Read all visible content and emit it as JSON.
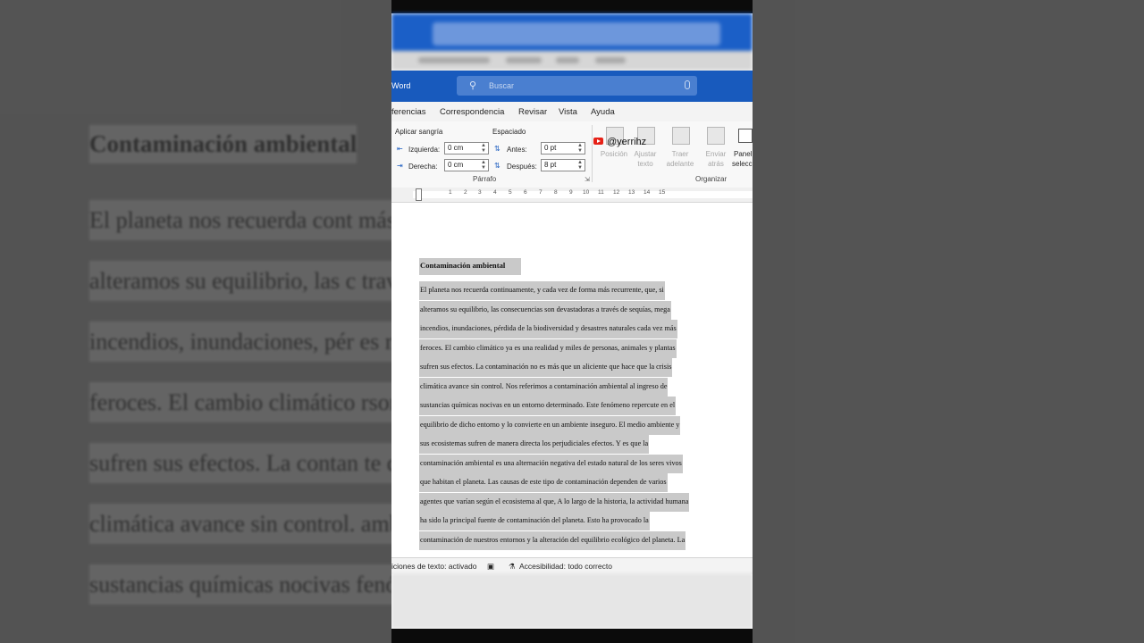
{
  "app": {
    "name": "Word"
  },
  "search": {
    "placeholder": "Buscar"
  },
  "tabs": [
    "ferencias",
    "Correspondencia",
    "Revisar",
    "Vista",
    "Ayuda"
  ],
  "ribbon": {
    "indent_label": "Aplicar sangría",
    "left_label": "Izquierda:",
    "left_value": "0 cm",
    "right_label": "Derecha:",
    "right_value": "0 cm",
    "spacing_label": "Espaciado",
    "before_label": "Antes:",
    "before_value": "0 pt",
    "after_label": "Después:",
    "after_value": "8 pt",
    "paragraph_group": "Párrafo",
    "organize_group": "Organizar",
    "position_label": "Posición",
    "wrap_label_1": "Ajustar",
    "wrap_label_2": "texto",
    "forward_label_1": "Traer",
    "forward_label_2": "adelante",
    "backward_label_1": "Enviar",
    "backward_label_2": "atrás",
    "pane_label_1": "Panel",
    "pane_label_2": "selecc"
  },
  "watermark": "@yerrihz",
  "ruler": {
    "ticks": [
      "1",
      "2",
      "3",
      "4",
      "5",
      "6",
      "7",
      "8",
      "9",
      "10",
      "11",
      "12",
      "13",
      "14",
      "15"
    ]
  },
  "document": {
    "title": "Contaminación ambiental",
    "lines": [
      "El planeta nos recuerda continuamente, y cada vez de forma más recurrente, que, si",
      "alteramos su equilibrio, las consecuencias son devastadoras a través de sequías, mega",
      "incendios, inundaciones, pérdida de la biodiversidad y desastres naturales cada vez más",
      "feroces. El cambio climático ya es una realidad y miles de personas, animales y plantas",
      "sufren sus efectos. La contaminación no es más que un aliciente que hace que la crisis",
      "climática avance sin control. Nos referimos a contaminación ambiental al ingreso de",
      "sustancias químicas nocivas en un entorno determinado. Este fenómeno repercute en el",
      "equilibrio de dicho entorno y lo convierte en un ambiente inseguro. El medio ambiente y",
      "sus ecosistemas sufren de manera directa los perjudiciales efectos.  Y es que la",
      "contaminación ambiental es una alternación negativa del estado natural de los seres vivos",
      "que habitan el planeta.  Las causas de este tipo de contaminación dependen de varios",
      "agentes que varían según el ecosistema al que, A lo largo de la historia, la actividad humana",
      "ha sido la principal fuente de contaminación del planeta. Esto ha provocado la",
      "contaminación de nuestros entornos y la alteración del equilibrio ecológico del planeta. La"
    ]
  },
  "background": {
    "title": "Contaminación ambiental",
    "lines": [
      "El planeta nos recuerda cont                         más recurrente, que, si",
      "alteramos su equilibrio, las c                         través de sequías, mega",
      "incendios, inundaciones, pér                         es naturales cada vez más",
      "feroces. El cambio climático                         rsonas, animales y plantas",
      "sufren sus efectos. La contan                         te que hace que la crisis",
      "climática avance sin control.                         ambiental al ingreso de",
      "sustancias químicas nocivas                         fenómeno repercute en el"
    ]
  },
  "status": {
    "predictions": "iciones de texto: activado",
    "accessibility": "Accesibilidad: todo correcto"
  },
  "colors": {
    "word_blue": "#185abd",
    "selection": "#c9c9c9"
  }
}
